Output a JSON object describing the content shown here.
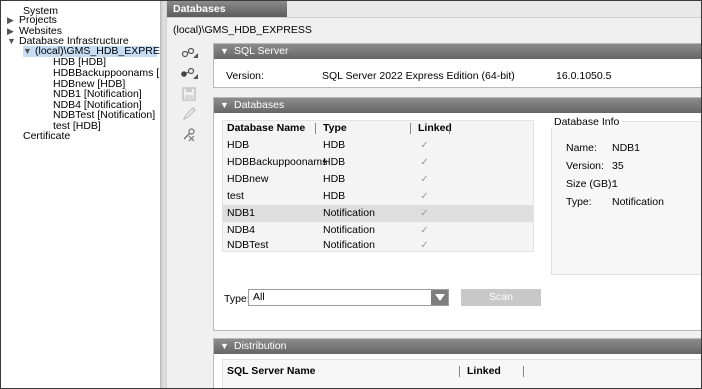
{
  "tree": {
    "items": [
      {
        "label": "System",
        "arrow": ""
      },
      {
        "label": "Projects",
        "arrow": "▶"
      },
      {
        "label": "Websites",
        "arrow": "▶"
      },
      {
        "label": "Database Infrastructure",
        "arrow": "▼"
      },
      {
        "label": "(local)\\GMS_HDB_EXPRESS",
        "arrow": "▼"
      },
      {
        "label": "HDB [HDB]",
        "arrow": ""
      },
      {
        "label": "HDBBackuppoonams [HDE",
        "arrow": ""
      },
      {
        "label": "HDBnew [HDB]",
        "arrow": ""
      },
      {
        "label": "NDB1 [Notification]",
        "arrow": ""
      },
      {
        "label": "NDB4 [Notification]",
        "arrow": ""
      },
      {
        "label": "NDBTest [Notification]",
        "arrow": ""
      },
      {
        "label": "test [HDB]",
        "arrow": ""
      },
      {
        "label": "Certificate",
        "arrow": ""
      }
    ]
  },
  "tab": {
    "label": "Databases"
  },
  "instance": "(local)\\GMS_HDB_EXPRESS",
  "toolbar_icons": [
    "add-database-icon",
    "add-database-alt-icon",
    "save-icon",
    "edit-icon",
    "delete-icon"
  ],
  "sql_server": {
    "header": "SQL Server",
    "version_label": "Version:",
    "edition": "SQL Server 2022 Express Edition (64-bit)",
    "version_number": "16.0.1050.5"
  },
  "databases": {
    "header": "Databases",
    "columns": [
      "Database Name",
      "Type",
      "Linked"
    ],
    "rows": [
      {
        "name": "HDB",
        "type": "HDB",
        "linked": true
      },
      {
        "name": "HDBBackuppoonams",
        "type": "HDB",
        "linked": true
      },
      {
        "name": "HDBnew",
        "type": "HDB",
        "linked": true
      },
      {
        "name": "test",
        "type": "HDB",
        "linked": true
      },
      {
        "name": "NDB1",
        "type": "Notification",
        "linked": true
      },
      {
        "name": "NDB4",
        "type": "Notification",
        "linked": true
      },
      {
        "name": "NDBTest",
        "type": "Notification",
        "linked": true
      }
    ],
    "selected_row": 4,
    "info": {
      "title": "Database Info",
      "name_label": "Name:",
      "name_value": "NDB1",
      "version_label": "Version:",
      "version_value": "35",
      "size_label": "Size (GB):",
      "size_value": "1",
      "type_label": "Type:",
      "type_value": "Notification"
    },
    "type_filter_label": "Type:",
    "type_filter_value": "All",
    "scan_label": "Scan"
  },
  "distribution": {
    "header": "Distribution",
    "columns": [
      "SQL Server Name",
      "Linked"
    ]
  }
}
